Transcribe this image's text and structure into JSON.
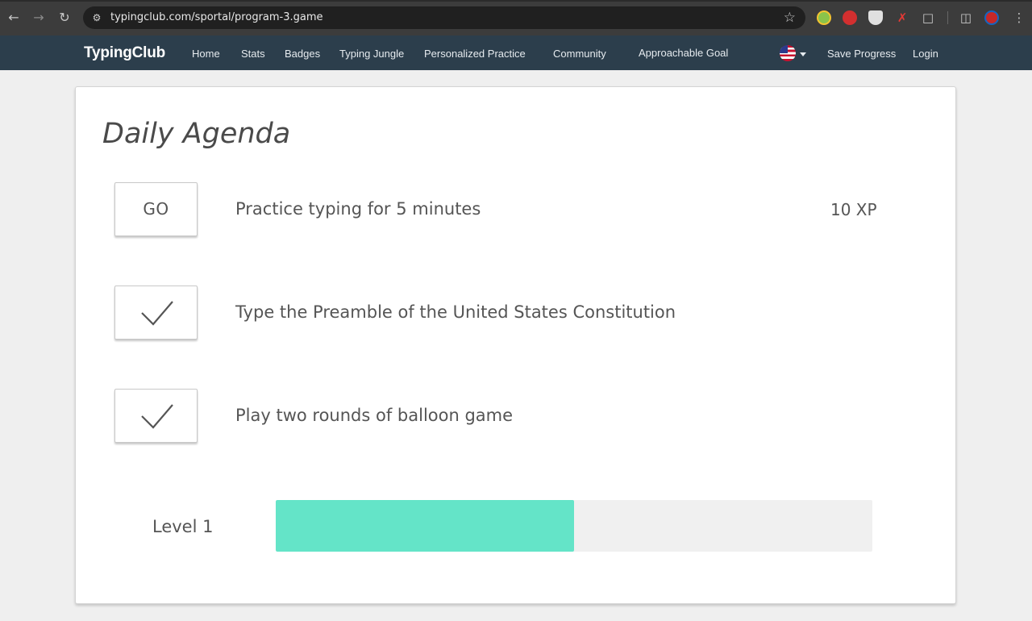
{
  "browser": {
    "url": "typingclub.com/sportal/program-3.game"
  },
  "header": {
    "logo": "TypingClub",
    "nav": [
      {
        "label": "Home"
      },
      {
        "label": "Stats"
      },
      {
        "label": "Badges"
      },
      {
        "label": "Typing Jungle"
      },
      {
        "label": "Personalized Practice"
      },
      {
        "label": "Community"
      },
      {
        "label": "Approachable Goal"
      }
    ],
    "language_icon": "us-flag-icon",
    "save_progress": "Save Progress",
    "login": "Login"
  },
  "agenda": {
    "title": "Daily Agenda",
    "tasks": [
      {
        "status": "go",
        "button_label": "GO",
        "text": "Practice typing for 5 minutes",
        "xp": "10 XP"
      },
      {
        "status": "done",
        "icon": "checkmark-icon",
        "text": "Type the Preamble of the United States Constitution"
      },
      {
        "status": "done",
        "icon": "checkmark-icon",
        "text": "Play two rounds of balloon game"
      }
    ],
    "level": {
      "label": "Level 1",
      "progress": 0.5,
      "fill_color": "#64e4c8",
      "track_color": "#f0f0f0"
    }
  },
  "colors": {
    "header_bg": "#2c3e4c",
    "page_bg": "#efefef",
    "accent": "#64e4c8"
  }
}
